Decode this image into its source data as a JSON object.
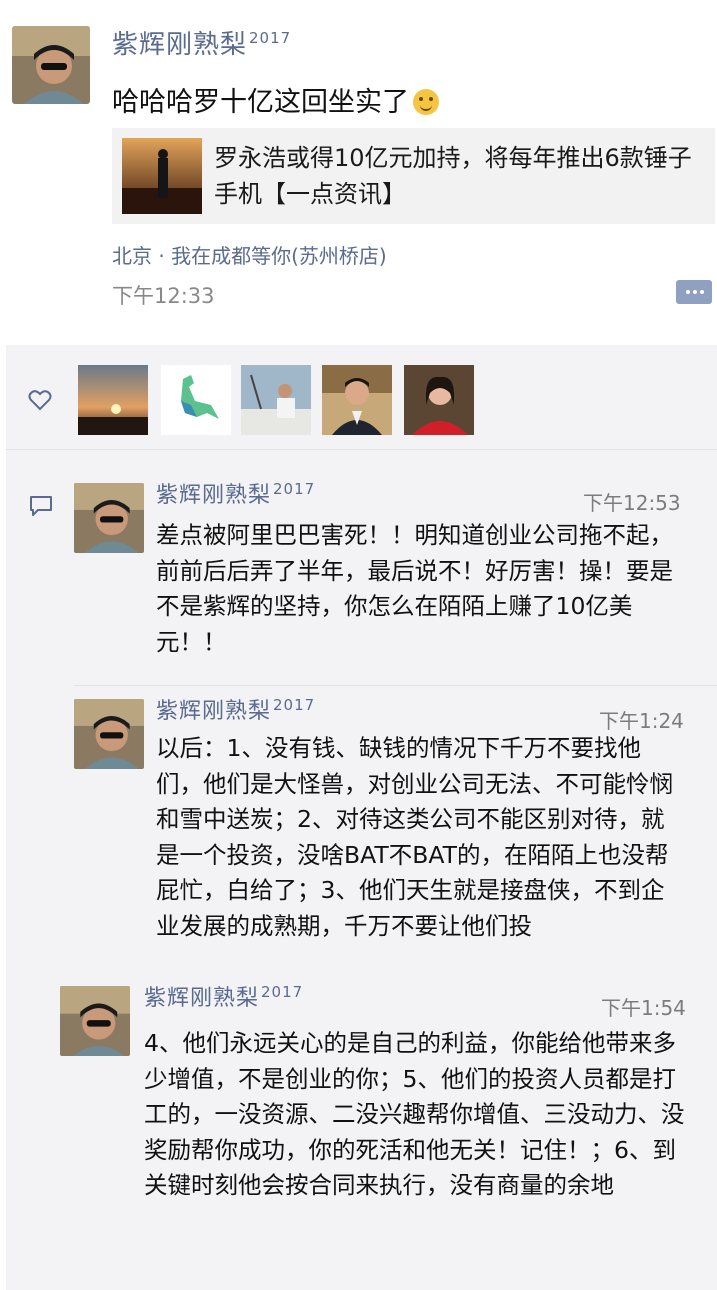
{
  "post": {
    "username": "紫辉刚熟梨",
    "username_sup": "2017",
    "text": "哈哈哈罗十亿这回坐实了",
    "link_title": "罗永浩或得10亿元加持，将每年推出6款锤子手机【一点资讯】",
    "location": "北京 · 我在成都等你(苏州桥店)",
    "time": "下午12:33"
  },
  "icons": {
    "emoji": "thinking-emoji-icon",
    "more": "more-dots-icon",
    "like": "heart-icon",
    "comment": "comment-bubble-icon"
  },
  "likers": [
    {
      "name": "sunset-avatar"
    },
    {
      "name": "dinosaur-logo-avatar"
    },
    {
      "name": "boat-photo-avatar"
    },
    {
      "name": "man-suit-avatar"
    },
    {
      "name": "woman-red-avatar"
    }
  ],
  "comments": [
    {
      "username": "紫辉刚熟梨",
      "username_sup": "2017",
      "time": "下午12:53",
      "text": "差点被阿里巴巴害死！！明知道创业公司拖不起，前前后后弄了半年，最后说不！好厉害！操！要是不是紫辉的坚持，你怎么在陌陌上赚了10亿美元！！"
    },
    {
      "username": "紫辉刚熟梨",
      "username_sup": "2017",
      "time": "下午1:24",
      "text": "以后：1、没有钱、缺钱的情况下千万不要找他们，他们是大怪兽，对创业公司无法、不可能怜悯和雪中送炭；2、对待这类公司不能区别对待，就是一个投资，没啥BAT不BAT的，在陌陌上也没帮屁忙，白给了；3、他们天生就是接盘侠，不到企业发展的成熟期，千万不要让他们投"
    },
    {
      "username": "紫辉刚熟梨",
      "username_sup": "2017",
      "time": "下午1:54",
      "text": "4、他们永远关心的是自己的利益，你能给他带来多少增值，不是创业的你；5、他们的投资人员都是打工的，一没资源、二没兴趣帮你增值、三没动力、没奖励帮你成功，你的死活和他无关！记住！；6、到关键时刻他会按合同来执行，没有商量的余地"
    }
  ],
  "colors": {
    "name": "#5a6b8f",
    "time": "#888888",
    "panel": "#f3f3f5",
    "link_bg": "#f2f2f2"
  }
}
